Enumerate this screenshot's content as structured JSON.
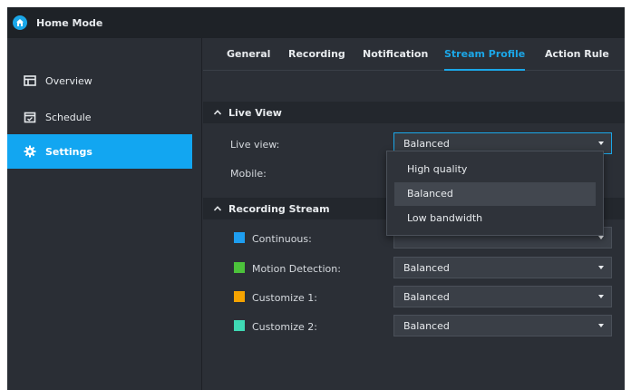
{
  "window": {
    "title": "Home Mode"
  },
  "sidebar": {
    "items": [
      {
        "label": "Overview",
        "icon": "overview-icon"
      },
      {
        "label": "Schedule",
        "icon": "calendar-icon"
      },
      {
        "label": "Settings",
        "icon": "gear-icon",
        "active": true
      }
    ]
  },
  "tabs": [
    {
      "label": "General"
    },
    {
      "label": "Recording"
    },
    {
      "label": "Notification"
    },
    {
      "label": "Stream Profile",
      "active": true
    },
    {
      "label": "Action Rule"
    }
  ],
  "live_view": {
    "title": "Live View",
    "live_view_label": "Live view:",
    "live_view_value": "Balanced",
    "mobile_label": "Mobile:",
    "dropdown_options": [
      "High quality",
      "Balanced",
      "Low bandwidth"
    ]
  },
  "recording_stream": {
    "title": "Recording Stream",
    "rows": [
      {
        "label": "Continuous:",
        "value": "",
        "color": "#1e9ef0"
      },
      {
        "label": "Motion Detection:",
        "value": "Balanced",
        "color": "#4cc23b"
      },
      {
        "label": "Customize 1:",
        "value": "Balanced",
        "color": "#f5a300"
      },
      {
        "label": "Customize 2:",
        "value": "Balanced",
        "color": "#3fd9b4"
      }
    ]
  },
  "colors": {
    "accent": "#1ba7e8",
    "titlebar": "#1e2227",
    "background": "#2b2f36"
  }
}
